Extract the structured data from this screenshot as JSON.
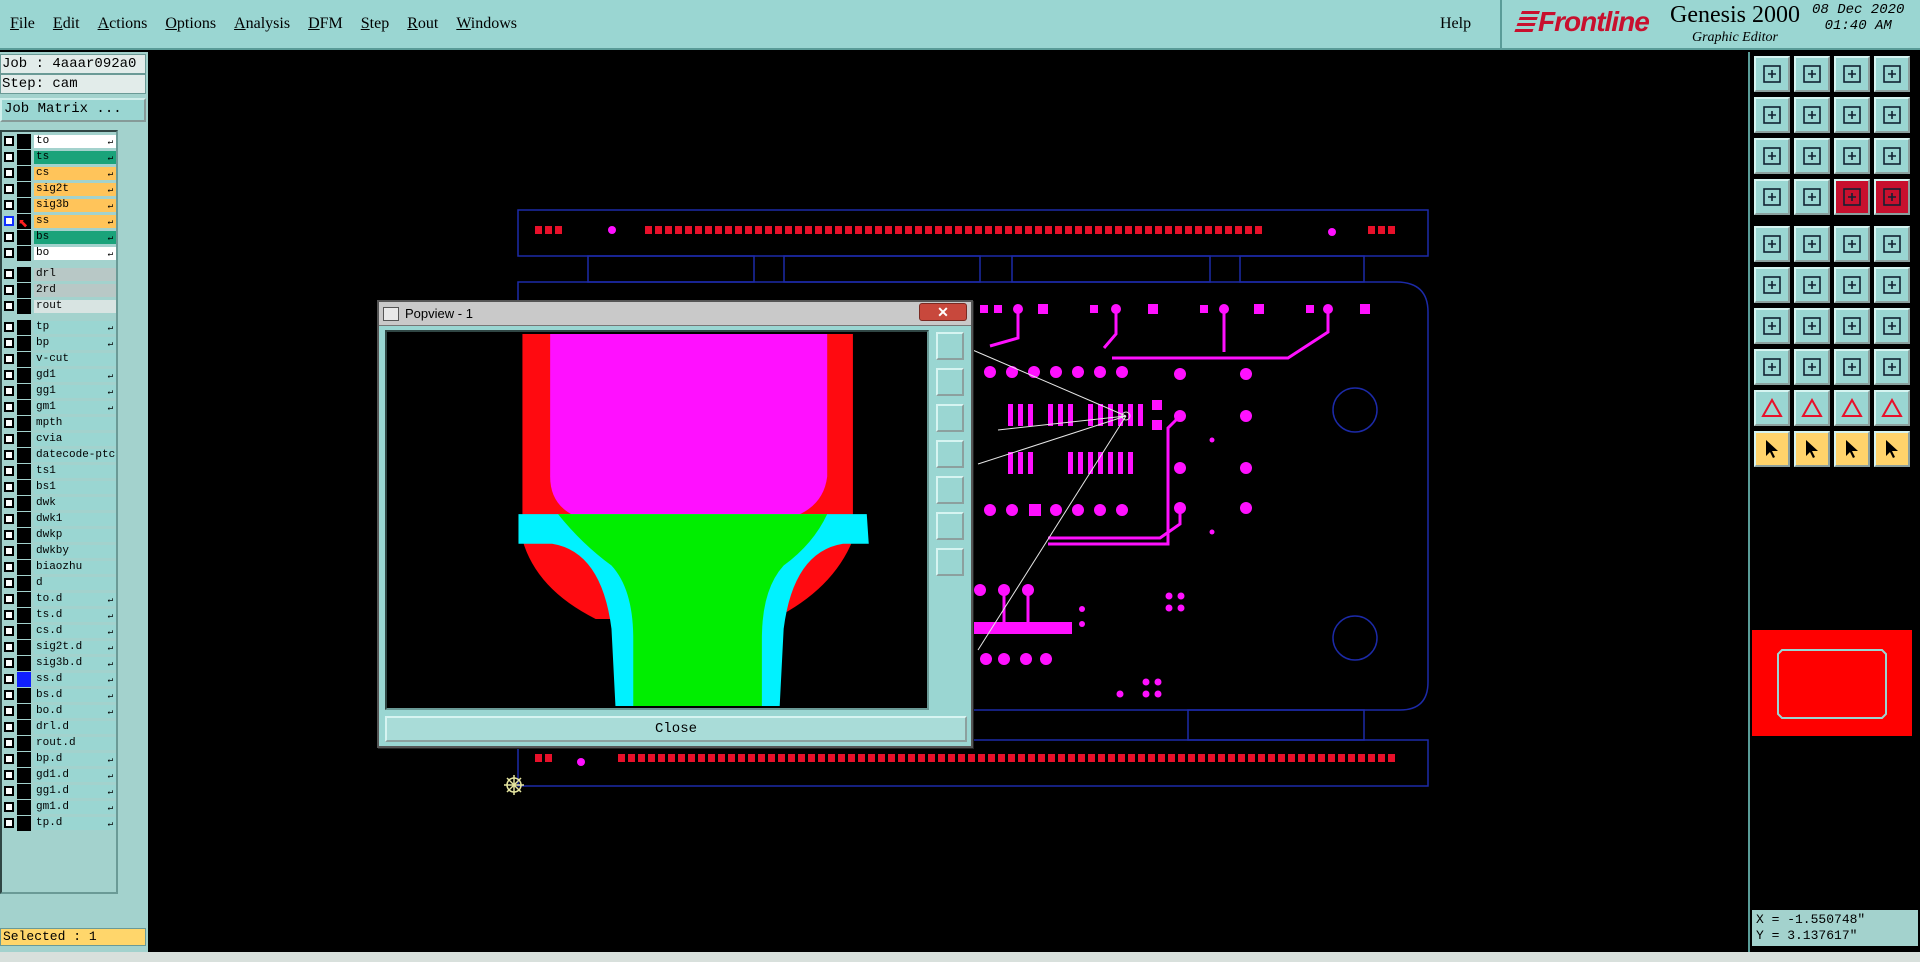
{
  "menu": {
    "items": [
      {
        "label": "File",
        "ul": "F",
        "rest": "ile"
      },
      {
        "label": "Edit",
        "ul": "E",
        "rest": "dit"
      },
      {
        "label": "Actions",
        "ul": "A",
        "rest": "ctions"
      },
      {
        "label": "Options",
        "ul": "O",
        "rest": "ptions"
      },
      {
        "label": "Analysis",
        "ul": "A",
        "rest": "nalysis"
      },
      {
        "label": "DFM",
        "ul": "D",
        "rest": "FM"
      },
      {
        "label": "Step",
        "ul": "S",
        "rest": "tep"
      },
      {
        "label": "Rout",
        "ul": "R",
        "rest": "out"
      },
      {
        "label": "Windows",
        "ul": "W",
        "rest": "indows"
      }
    ],
    "help": "Help"
  },
  "brand": {
    "logo": "Frontline",
    "product": "Genesis 2000",
    "subtitle": "Graphic Editor",
    "date": "08 Dec 2020",
    "time": "01:40 AM"
  },
  "job": {
    "job_line": "Job : 4aaar092a0",
    "step_line": "Step: cam",
    "matrix_button": "Job Matrix ..."
  },
  "layers": [
    {
      "name": "to",
      "color": "#ffffff",
      "arrow": true
    },
    {
      "name": "ts",
      "color": "#1aa37a",
      "arrow": true
    },
    {
      "name": "cs",
      "color": "#ffc45a",
      "arrow": true
    },
    {
      "name": "sig2t",
      "color": "#ffc45a",
      "arrow": true
    },
    {
      "name": "sig3b",
      "color": "#ffc45a",
      "arrow": true
    },
    {
      "name": "ss",
      "color": "#ffc45a",
      "arrow": true,
      "active": true
    },
    {
      "name": "bs",
      "color": "#1aa37a",
      "arrow": true
    },
    {
      "name": "bo",
      "color": "#ffffff",
      "arrow": true
    },
    {
      "gap": true
    },
    {
      "name": "drl",
      "color": "#b8c8c6",
      "arrow": false
    },
    {
      "name": "2rd",
      "color": "#b8c8c6",
      "arrow": false
    },
    {
      "name": "rout",
      "color": "#d8e4e2",
      "arrow": false
    },
    {
      "gap": true
    },
    {
      "name": "tp",
      "color": "#9ad6d2",
      "arrow": true
    },
    {
      "name": "bp",
      "color": "#9ad6d2",
      "arrow": true
    },
    {
      "name": "v-cut",
      "color": "#9ad6d2",
      "arrow": false
    },
    {
      "name": "gd1",
      "color": "#9ad6d2",
      "arrow": true
    },
    {
      "name": "gg1",
      "color": "#9ad6d2",
      "arrow": true
    },
    {
      "name": "gm1",
      "color": "#9ad6d2",
      "arrow": true
    },
    {
      "name": "mpth",
      "color": "#9ad6d2",
      "arrow": false
    },
    {
      "name": "cvia",
      "color": "#9ad6d2",
      "arrow": false
    },
    {
      "name": "datecode-ptc",
      "color": "#9ad6d2",
      "arrow": false
    },
    {
      "name": "ts1",
      "color": "#9ad6d2",
      "arrow": false
    },
    {
      "name": "bs1",
      "color": "#9ad6d2",
      "arrow": false
    },
    {
      "name": "dwk",
      "color": "#9ad6d2",
      "arrow": false
    },
    {
      "name": "dwk1",
      "color": "#9ad6d2",
      "arrow": false
    },
    {
      "name": "dwkp",
      "color": "#9ad6d2",
      "arrow": false
    },
    {
      "name": "dwkby",
      "color": "#9ad6d2",
      "arrow": false
    },
    {
      "name": "biaozhu",
      "color": "#9ad6d2",
      "arrow": false
    },
    {
      "name": "d",
      "color": "#9ad6d2",
      "arrow": false
    },
    {
      "name": "to.d",
      "color": "#9ad6d2",
      "arrow": true
    },
    {
      "name": "ts.d",
      "color": "#9ad6d2",
      "arrow": true
    },
    {
      "name": "cs.d",
      "color": "#9ad6d2",
      "arrow": true
    },
    {
      "name": "sig2t.d",
      "color": "#9ad6d2",
      "arrow": true
    },
    {
      "name": "sig3b.d",
      "color": "#9ad6d2",
      "arrow": true
    },
    {
      "name": "ss.d",
      "color": "#9ad6d2",
      "arrow": true,
      "blue": true
    },
    {
      "name": "bs.d",
      "color": "#9ad6d2",
      "arrow": true
    },
    {
      "name": "bo.d",
      "color": "#9ad6d2",
      "arrow": true
    },
    {
      "name": "drl.d",
      "color": "#9ad6d2",
      "arrow": false
    },
    {
      "name": "rout.d",
      "color": "#9ad6d2",
      "arrow": false
    },
    {
      "name": "bp.d",
      "color": "#9ad6d2",
      "arrow": true
    },
    {
      "name": "gd1.d",
      "color": "#9ad6d2",
      "arrow": true
    },
    {
      "name": "gg1.d",
      "color": "#9ad6d2",
      "arrow": true
    },
    {
      "name": "gm1.d",
      "color": "#9ad6d2",
      "arrow": true
    },
    {
      "name": "tp.d",
      "color": "#9ad6d2",
      "arrow": true
    }
  ],
  "status": {
    "selected": "Selected : 1",
    "x": "X = -1.550748\"",
    "y": "Y = 3.137617\""
  },
  "popview": {
    "title": "Popview - 1",
    "close_icon": "close-x-icon",
    "close_button": "Close"
  },
  "toolbar_icons": [
    "open-step-icon",
    "save-icon",
    "home-icon",
    "window-icon",
    "zoom-left-icon",
    "zoom-right-icon",
    "pan-icon",
    "redraw-icon",
    "fit-icon",
    "zoom-in-icon",
    "scale-1-2-icon",
    "help-icon",
    "measure-icon",
    "grid-icon",
    "snap-net-icon",
    "snap-net-alt-icon",
    "pad-icon",
    "line-edit-icon",
    "ruler-icon",
    "circle-icon",
    "connect-icon",
    "cross-icon",
    "move-icon",
    "copy-icon",
    "angle-icon",
    "slope-icon",
    "arc-icon",
    "text-icon",
    "pin-icon",
    "minus-icon",
    "frame-icon",
    "group-icon",
    "triangle-icon",
    "triangle-a-icon",
    "triangle-b-icon",
    "triangle-c-icon",
    "select-arrow-icon",
    "select-box-icon",
    "select-poly-icon",
    "select-multi-icon"
  ],
  "colors": {
    "ui_teal": "#9ad6d2",
    "accent_yellow": "#ffd36b",
    "board_outline": "#1c2aa8",
    "pad_red": "#e8102a",
    "copper_magenta": "#ff10ff",
    "popview_green": "#00ee00",
    "popview_cyan": "#00f2ff"
  }
}
